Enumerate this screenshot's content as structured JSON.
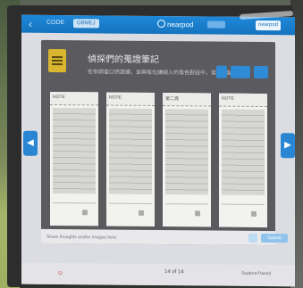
{
  "topbar": {
    "back_glyph": "‹",
    "code_label": "CODE",
    "code_value": "GBMEJ",
    "logo_text": "nearpod",
    "mid_pill": "",
    "right_logo": "nearpod"
  },
  "slide": {
    "title": "偵探們的蒐證筆記",
    "subtitle": "在你調查口供證據，並與每位嫌疑人的角色對話中，寫出重點",
    "buttons": [
      "",
      "",
      ""
    ]
  },
  "cards": [
    {
      "label": "NOTE"
    },
    {
      "label": "NOTE"
    },
    {
      "label": "第二頁"
    },
    {
      "label": "NOTE"
    }
  ],
  "compose": {
    "placeholder": "Share thoughts and/or images here",
    "submit_label": "Submit"
  },
  "nav": {
    "prev_glyph": "◀",
    "next_glyph": "▶"
  },
  "bottombar": {
    "presenter": "☺",
    "page": "14 of 14",
    "student_pace": "Student-Paced"
  }
}
